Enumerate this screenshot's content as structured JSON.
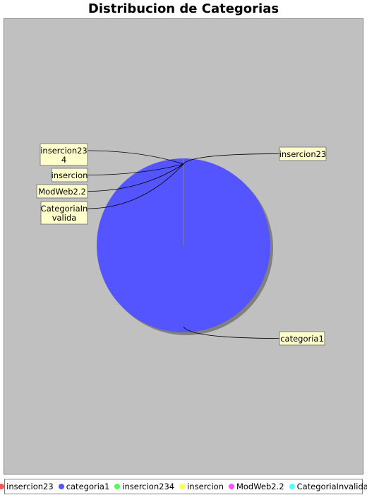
{
  "chart_data": {
    "type": "pie",
    "title": "Distribucion de Categorias",
    "slices": [
      {
        "label": "insercion23",
        "value": 0,
        "color": "#ff5555"
      },
      {
        "label": "categoria1",
        "value": 100,
        "color": "#5555ff"
      },
      {
        "label": "insercion234",
        "value": 0,
        "color": "#55ff55"
      },
      {
        "label": "insercion",
        "value": 0,
        "color": "#ffff55"
      },
      {
        "label": "ModWeb2.2",
        "value": 0,
        "color": "#ff55ff"
      },
      {
        "label": "CategoriaInvalida",
        "value": 0,
        "color": "#55ffff"
      }
    ],
    "legend_position": "bottom"
  }
}
